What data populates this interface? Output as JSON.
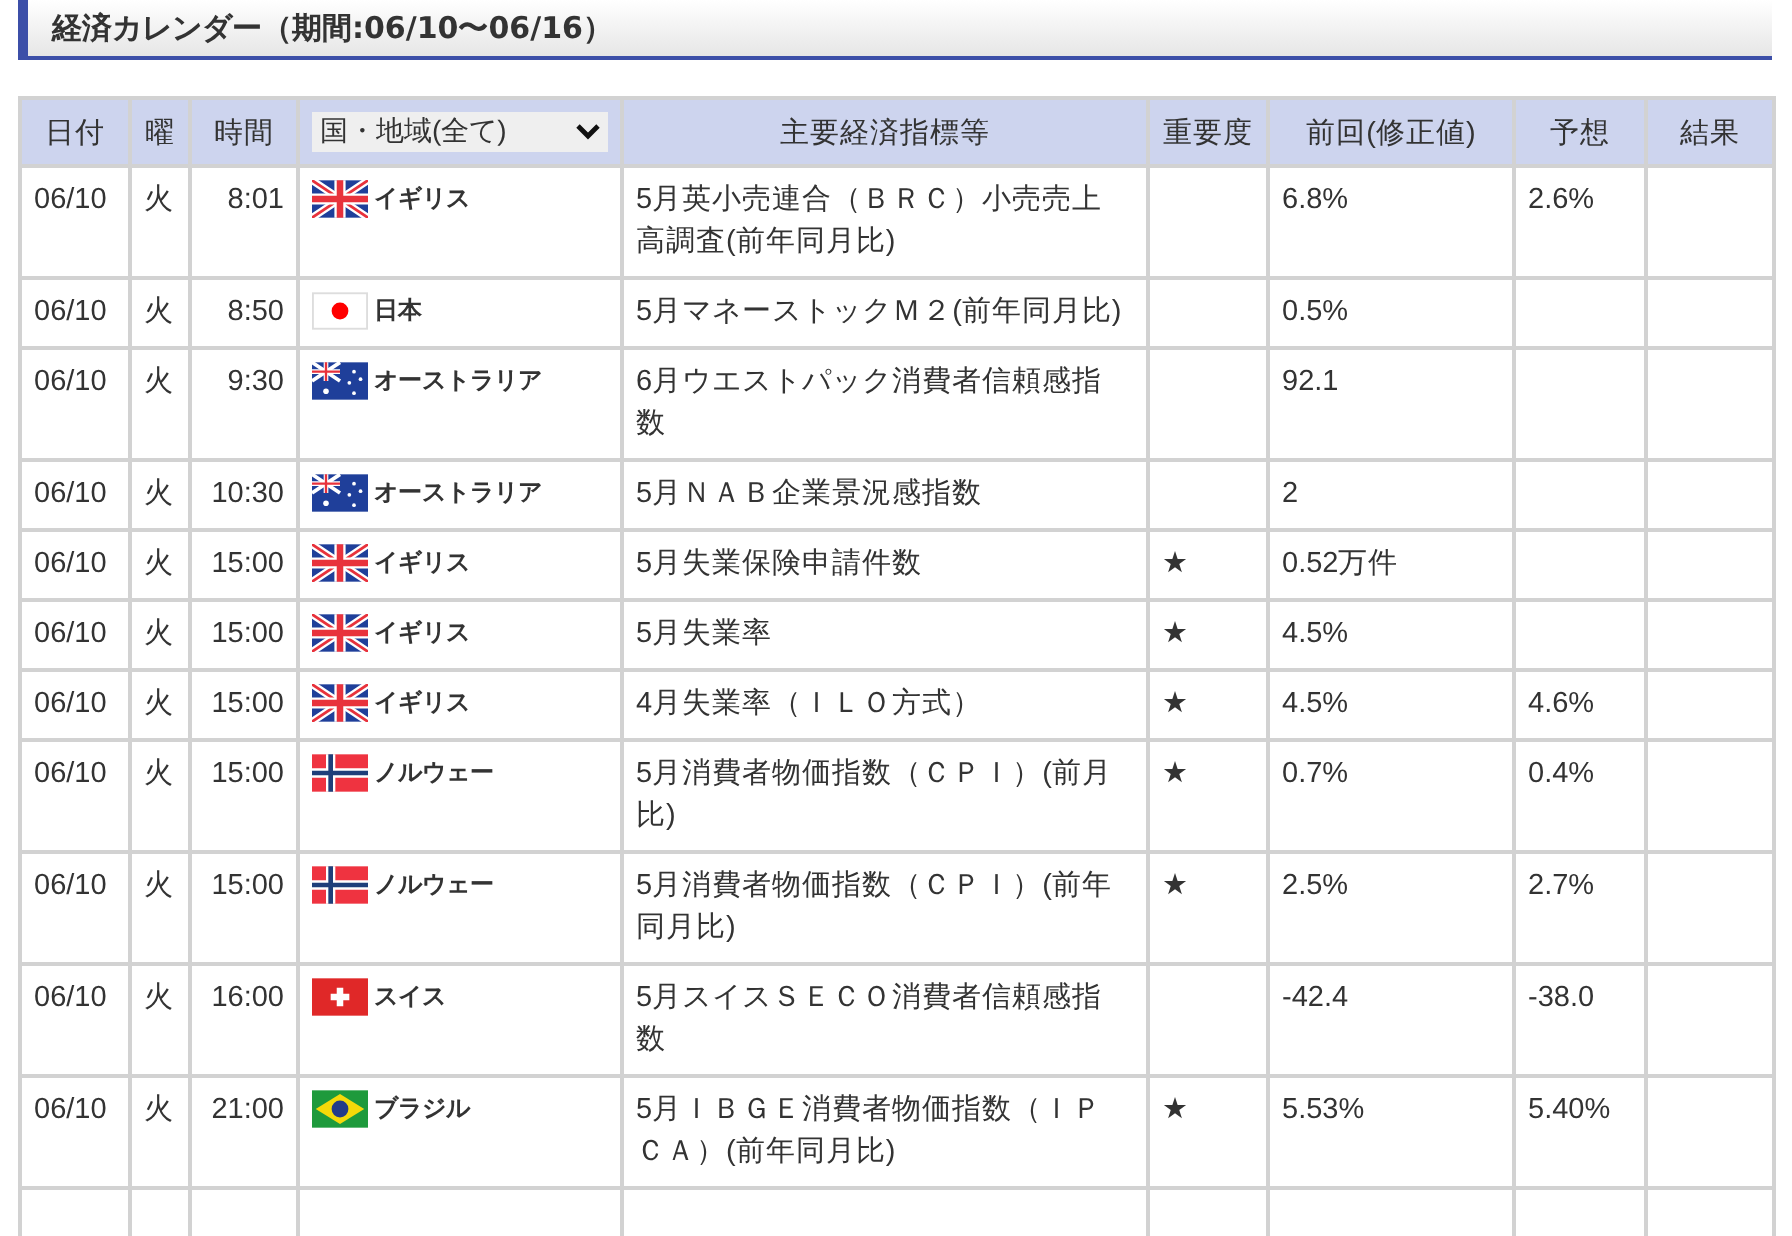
{
  "title": "経済カレンダー（期間:06/10〜06/16）",
  "columns": [
    "日付",
    "曜",
    "時間",
    "国・地域(全て)",
    "主要経済指標等",
    "重要度",
    "前回(修正値)",
    "予想",
    "結果"
  ],
  "rows": [
    {
      "date": "06/10",
      "day": "火",
      "time": "8:01",
      "kind": "uk",
      "country": "イギリス",
      "indicator": "5月英小売連合（ＢＲＣ）小売売上高調査(前年同月比)",
      "previous": "6.8%",
      "forecast": "2.6%"
    },
    {
      "date": "06/10",
      "day": "火",
      "time": "8:50",
      "kind": "jp",
      "country": "日本",
      "indicator": "5月マネーストックＭ２(前年同月比)",
      "previous": "0.5%"
    },
    {
      "date": "06/10",
      "day": "火",
      "time": "9:30",
      "kind": "au",
      "country": "オーストラリア",
      "indicator": "6月ウエストパック消費者信頼感指数",
      "previous": "92.1"
    },
    {
      "date": "06/10",
      "day": "火",
      "time": "10:30",
      "kind": "au",
      "country": "オーストラリア",
      "indicator": "5月ＮＡＢ企業景況感指数",
      "previous": "2"
    },
    {
      "date": "06/10",
      "day": "火",
      "time": "15:00",
      "kind": "uk",
      "country": "イギリス",
      "indicator": "5月失業保険申請件数",
      "importance": "★",
      "previous": "0.52万件"
    },
    {
      "date": "06/10",
      "day": "火",
      "time": "15:00",
      "kind": "uk",
      "country": "イギリス",
      "indicator": "5月失業率",
      "importance": "★",
      "previous": "4.5%"
    },
    {
      "date": "06/10",
      "day": "火",
      "time": "15:00",
      "kind": "uk",
      "country": "イギリス",
      "indicator": "4月失業率（ＩＬＯ方式）",
      "importance": "★",
      "previous": "4.5%",
      "forecast": "4.6%"
    },
    {
      "date": "06/10",
      "day": "火",
      "time": "15:00",
      "kind": "no",
      "country": "ノルウェー",
      "indicator": "5月消費者物価指数（ＣＰＩ）(前月比)",
      "importance": "★",
      "previous": "0.7%",
      "forecast": "0.4%"
    },
    {
      "date": "06/10",
      "day": "火",
      "time": "15:00",
      "kind": "no",
      "country": "ノルウェー",
      "indicator": "5月消費者物価指数（ＣＰＩ）(前年同月比)",
      "importance": "★",
      "previous": "2.5%",
      "forecast": "2.7%"
    },
    {
      "date": "06/10",
      "day": "火",
      "time": "16:00",
      "kind": "ch",
      "country": "スイス",
      "indicator": "5月スイスＳＥＣＯ消費者信頼感指数",
      "previous": "-42.4",
      "forecast": "-38.0"
    },
    {
      "date": "06/10",
      "day": "火",
      "time": "21:00",
      "kind": "br",
      "country": "ブラジル",
      "indicator": "5月ＩＢＧＥ消費者物価指数（ＩＰＣＡ）(前年同月比)",
      "importance": "★",
      "previous": "5.53%",
      "forecast": "5.40%"
    }
  ]
}
